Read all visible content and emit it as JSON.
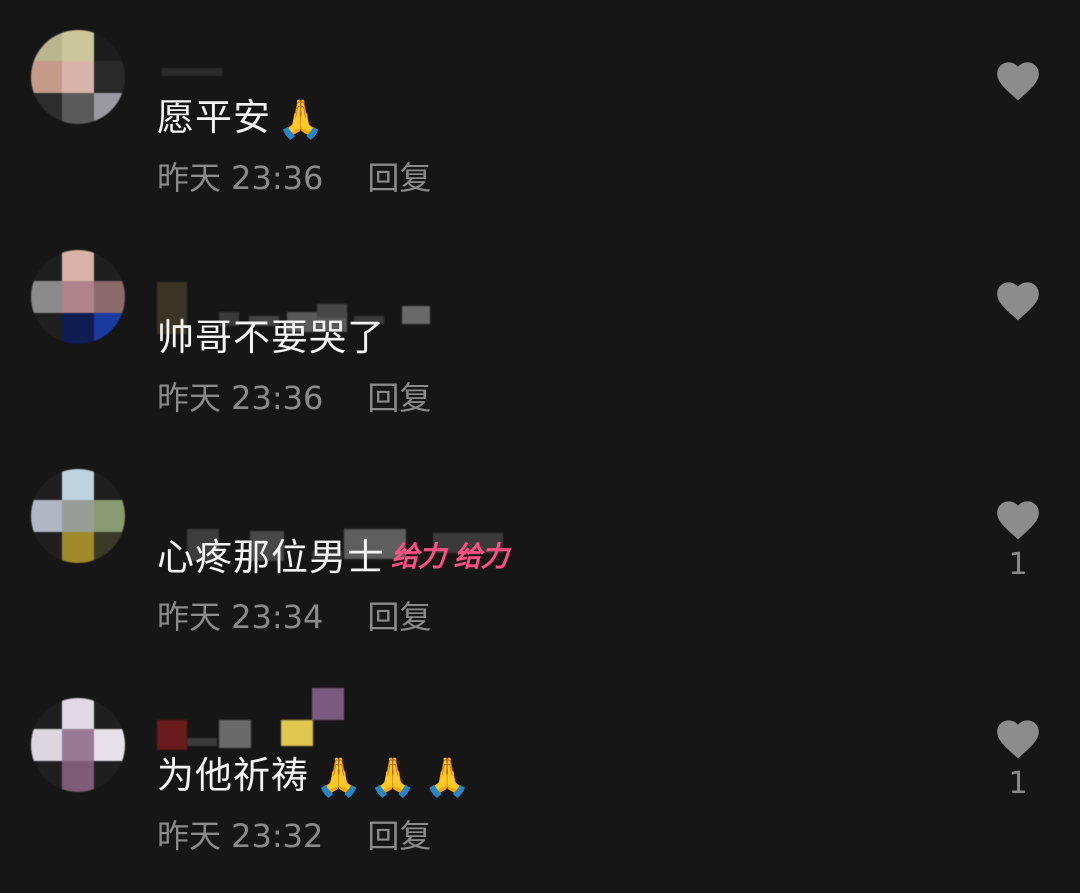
{
  "comments": [
    {
      "text": "愿平安",
      "emojis": [
        "🙏"
      ],
      "sticker": "",
      "time": "昨天 23:36",
      "reply_label": "回复",
      "likes": ""
    },
    {
      "text": "帅哥不要哭了",
      "emojis": [],
      "sticker": "",
      "time": "昨天 23:36",
      "reply_label": "回复",
      "likes": ""
    },
    {
      "text": "心疼那位男士",
      "emojis": [],
      "sticker": "给力 给力",
      "time": "昨天 23:34",
      "reply_label": "回复",
      "likes": "1"
    },
    {
      "text": "为他祈祷",
      "emojis": [
        "🙏",
        "🙏",
        "🙏"
      ],
      "sticker": "",
      "time": "昨天 23:32",
      "reply_label": "回复",
      "likes": "1"
    }
  ],
  "icons": {
    "like": "heart-icon"
  },
  "colors": {
    "background": "#161616",
    "text": "#f4f4f4",
    "meta": "#8a8a8a",
    "heart": "#8c8c8c",
    "sticker": "#ff4f86"
  }
}
